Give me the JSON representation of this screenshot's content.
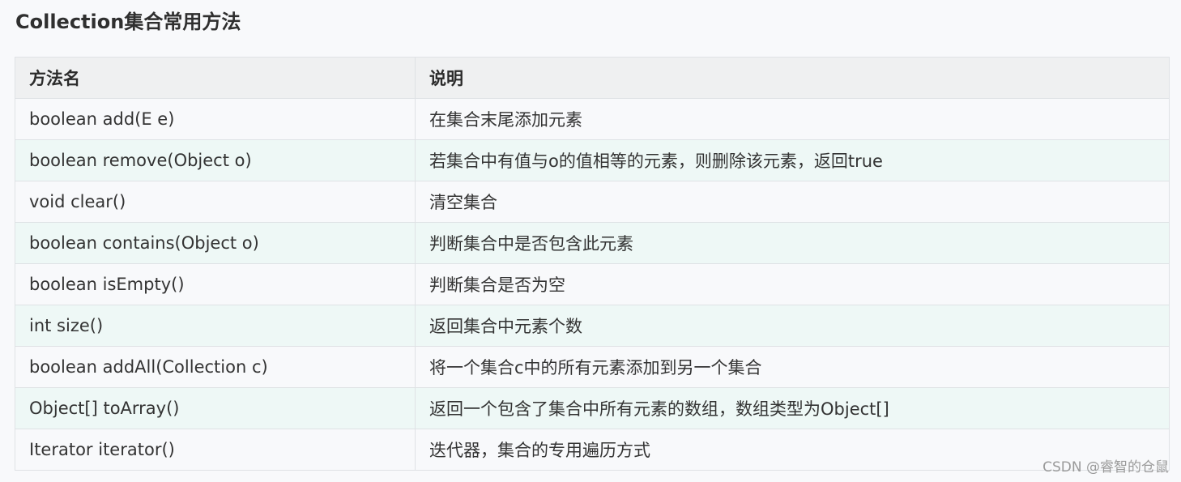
{
  "title": "Collection集合常用方法",
  "table": {
    "headers": [
      "方法名",
      "说明"
    ],
    "rows": [
      [
        "boolean add(E e)",
        "在集合末尾添加元素"
      ],
      [
        "boolean remove(Object o)",
        "若集合中有值与o的值相等的元素，则删除该元素，返回true"
      ],
      [
        "void clear()",
        "清空集合"
      ],
      [
        "boolean contains(Object o)",
        "判断集合中是否包含此元素"
      ],
      [
        "boolean isEmpty()",
        "判断集合是否为空"
      ],
      [
        "int size()",
        "返回集合中元素个数"
      ],
      [
        "boolean addAll(Collection c)",
        "将一个集合c中的所有元素添加到另一个集合"
      ],
      [
        "Object[] toArray()",
        "返回一个包含了集合中所有元素的数组，数组类型为Object[]"
      ],
      [
        "Iterator iterator()",
        "迭代器，集合的专用遍历方式"
      ]
    ]
  },
  "watermark": "CSDN @睿智的仓鼠",
  "colors": {
    "header_background": "#eff0f1",
    "row_background": "#f8f9fb",
    "alternate_row_background": "#eef8f6",
    "border": "#dfe2e5",
    "text": "#333333"
  }
}
